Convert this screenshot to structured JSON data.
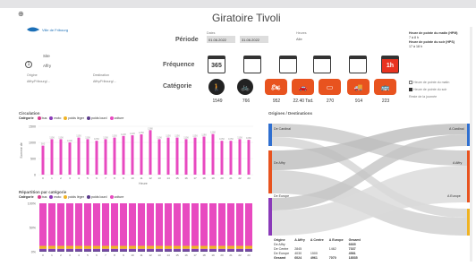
{
  "header": {
    "title": "Giratoire Tivoli",
    "logo_text": "Ville de Fribourg",
    "back_icon": "back-arrow-icon"
  },
  "periode": {
    "label": "Période",
    "date_label": "Dates",
    "start": "01.06.2022",
    "end": "31.06.2022",
    "heures_label": "Heures",
    "heures_value": "Alle"
  },
  "site": {
    "label": "Site",
    "value": "Affry",
    "origine_label": "Origine",
    "origine_value": "Affry/Fribourg/...",
    "destination_label": "Destination",
    "destination_value": "Affry/Fribourg/..."
  },
  "frequence": {
    "label": "Fréquence",
    "items": [
      {
        "name": "year-calendar-icon",
        "text": "365"
      },
      {
        "name": "month-calendar-icon",
        "text": ""
      },
      {
        "name": "week-calendar-icon",
        "text": ""
      },
      {
        "name": "weekday-calendar-icon",
        "text": ""
      },
      {
        "name": "weekend-calendar-icon",
        "text": ""
      },
      {
        "name": "day-calendar-icon",
        "text": "1h"
      }
    ]
  },
  "categorie": {
    "label": "Catégorie",
    "items": [
      {
        "name": "pedestrian-icon",
        "count": "1549",
        "color": "#222222"
      },
      {
        "name": "bicycle-icon",
        "count": "766",
        "color": "#222222"
      },
      {
        "name": "motorcycle-icon",
        "count": "952",
        "color": "#e8531f"
      },
      {
        "name": "car-icon",
        "count": "22.40 Tsd.",
        "color": "#e8531f"
      },
      {
        "name": "van-icon",
        "count": "270",
        "color": "#e8531f"
      },
      {
        "name": "truck-icon",
        "count": "914",
        "color": "#e8531f"
      },
      {
        "name": "bus-icon",
        "count": "223",
        "color": "#e8531f"
      }
    ]
  },
  "right_info": {
    "morning": "Heure de pointe du matin (HPM)",
    "morning_val": "7 à 8 h",
    "evening": "Heure de pointe du soir (HPS)",
    "evening_val": "17 à 18 h",
    "chk1": "Heure de pointe du matin",
    "chk2": "Heure de pointe du soir",
    "chk3": "Reste de la journée"
  },
  "legend_common": {
    "cat_label": "Catégorie",
    "items": [
      {
        "label": "bus",
        "color": "#d83a8f"
      },
      {
        "label": "moto",
        "color": "#8a3ab9"
      },
      {
        "label": "poids léger",
        "color": "#f0b323"
      },
      {
        "label": "poids lourd",
        "color": "#5a3a8a"
      },
      {
        "label": "voiture",
        "color": "#e84ac0"
      }
    ]
  },
  "circulation": {
    "title": "Circulation",
    "ylabel": "Somme de",
    "xlabel": "Heure",
    "yticks": [
      "1500",
      "1000",
      "500",
      "0"
    ]
  },
  "repartition": {
    "title": "Répartition par catégorie",
    "yticks": [
      "100%",
      "50%",
      "0%"
    ]
  },
  "sankey": {
    "title": "Origines / Destinations",
    "left": [
      "De Cardinal",
      "De Affry",
      "De Europe"
    ],
    "right": [
      "A Cardinal",
      "A Affry",
      "A Europe"
    ]
  },
  "matrix": {
    "headers": [
      "Origine",
      "A Affry",
      "A Centre",
      "A Europe",
      "Gesamt"
    ],
    "rows": [
      [
        "De Affry",
        "",
        "",
        "",
        "6665"
      ],
      [
        "De Centre",
        "2845",
        "",
        "1462",
        "7337"
      ],
      [
        "De Europe",
        "4030",
        "1500",
        "",
        "4581"
      ],
      [
        "Gesamt",
        "6024",
        "4961",
        "7070",
        "18535"
      ]
    ]
  },
  "chart_data": [
    {
      "type": "bar",
      "title": "Circulation",
      "ylabel": "Somme de",
      "xlabel": "Heure",
      "ylim": [
        0,
        1500
      ],
      "categories": [
        "0",
        "1",
        "2",
        "3",
        "4",
        "5",
        "6",
        "7",
        "8",
        "9",
        "10",
        "11",
        "12",
        "13",
        "14",
        "15",
        "16",
        "17",
        "18",
        "19",
        "20",
        "21",
        "22",
        "23"
      ],
      "values": [
        900,
        1100,
        1100,
        1000,
        1150,
        1100,
        1050,
        1100,
        1150,
        1200,
        1220,
        1250,
        1380,
        1100,
        1150,
        1150,
        1100,
        1150,
        1180,
        1260,
        1050,
        1050,
        1100,
        1080
      ]
    },
    {
      "type": "bar",
      "title": "Répartition par catégorie",
      "ylim": [
        0,
        100
      ],
      "categories": [
        "0",
        "1",
        "2",
        "3",
        "4",
        "5",
        "6",
        "7",
        "8",
        "9",
        "10",
        "11",
        "12",
        "13",
        "14",
        "15",
        "16",
        "17",
        "18",
        "19",
        "20",
        "21",
        "22",
        "23"
      ],
      "series": [
        {
          "name": "voiture",
          "values": [
            88,
            88,
            88,
            88,
            88,
            88,
            88,
            88,
            88,
            88,
            88,
            88,
            88,
            88,
            88,
            88,
            88,
            88,
            88,
            88,
            88,
            88,
            88,
            88
          ]
        },
        {
          "name": "poids léger",
          "values": [
            6,
            6,
            6,
            6,
            6,
            6,
            6,
            6,
            6,
            6,
            6,
            6,
            6,
            6,
            6,
            6,
            6,
            6,
            6,
            6,
            6,
            6,
            6,
            6
          ]
        },
        {
          "name": "moto",
          "values": [
            3,
            3,
            3,
            3,
            3,
            3,
            3,
            3,
            3,
            3,
            3,
            3,
            3,
            3,
            3,
            3,
            3,
            3,
            3,
            3,
            3,
            3,
            3,
            3
          ]
        },
        {
          "name": "poids lourd",
          "values": [
            3,
            3,
            3,
            3,
            3,
            3,
            3,
            3,
            3,
            3,
            3,
            3,
            3,
            3,
            3,
            3,
            3,
            3,
            3,
            3,
            3,
            3,
            3,
            3
          ]
        }
      ]
    }
  ]
}
